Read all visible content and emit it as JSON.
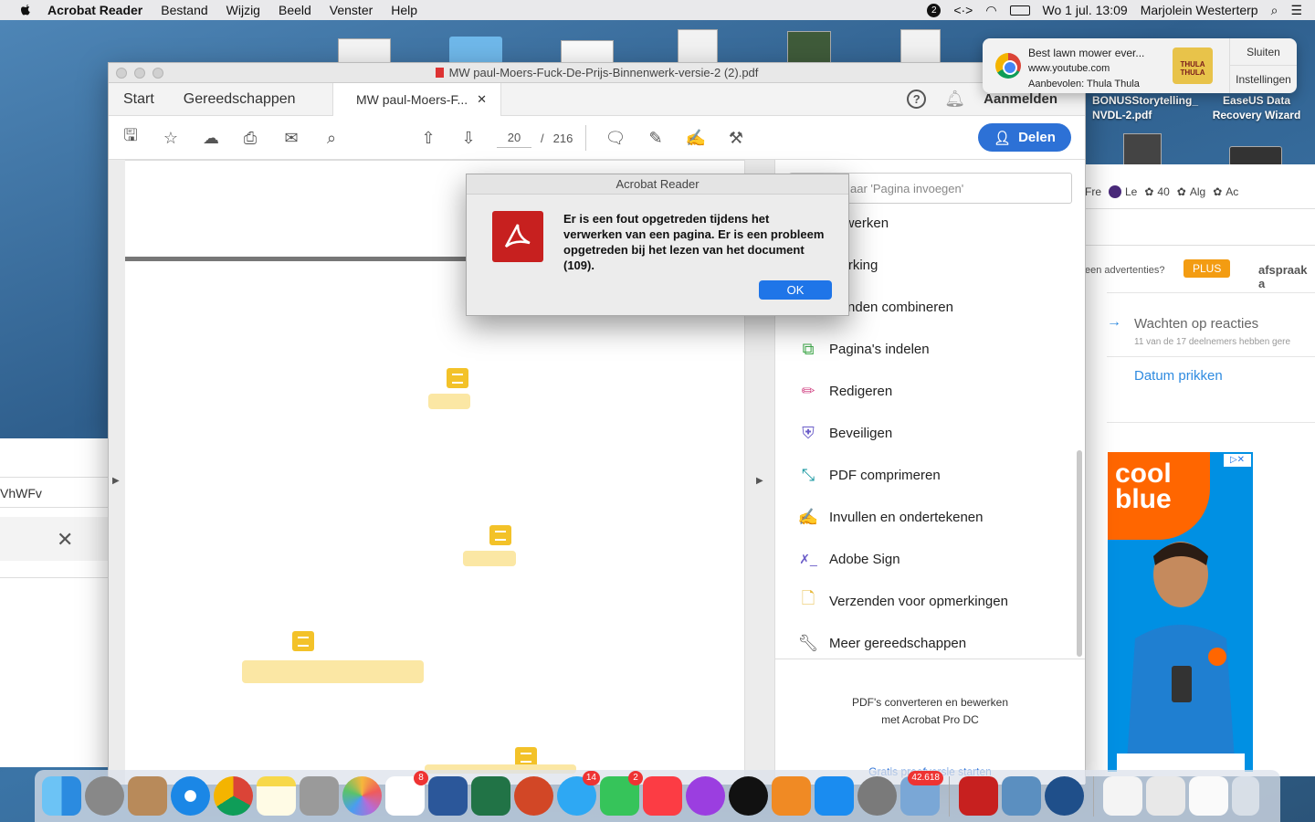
{
  "menubar": {
    "app_name": "Acrobat Reader",
    "menus": [
      "Bestand",
      "Wijzig",
      "Beeld",
      "Venster",
      "Help"
    ],
    "clock": "Wo 1 jul.  13:09",
    "user": "Marjolein Westerterp"
  },
  "acrobat": {
    "window_title": "MW paul-Moers-Fuck-De-Prijs-Binnenwerk-versie-2 (2).pdf",
    "tabs": {
      "start": "Start",
      "tools": "Gereedschappen",
      "doc": "MW paul-Moers-F..."
    },
    "sign_in": "Aanmelden",
    "page_current": "20",
    "page_total": "216",
    "share_label": "Delen",
    "tools_search_placeholder": "aar 'Pagina invoegen'",
    "tool_items": [
      "bewerken",
      "merking",
      "standen combineren",
      "Pagina's indelen",
      "Redigeren",
      "Beveiligen",
      "PDF comprimeren",
      "Invullen en ondertekenen",
      "Adobe Sign",
      "Verzenden voor opmerkingen",
      "Meer gereedschappen"
    ],
    "promo_text_1": "PDF's converteren en bewerken",
    "promo_text_2": "met Acrobat Pro DC",
    "promo_link": "Gratis proefversie starten"
  },
  "dialog": {
    "title": "Acrobat Reader",
    "message": "Er is een fout opgetreden tijdens het verwerken van een pagina. Er is een probleem opgetreden bij het lezen van het document (109).",
    "ok_label": "OK"
  },
  "notification": {
    "title": "Best lawn mower ever...",
    "site": "www.youtube.com",
    "recommended": "Aanbevolen: Thula Thula",
    "thumb_text": "THULA THULA",
    "close_label": "Sluiten",
    "settings_label": "Instellingen"
  },
  "desktop_files": [
    {
      "name": "BONUSStorytelling_NVDL-2.pdf"
    },
    {
      "name": "EaseUS Data Recovery Wizard"
    }
  ],
  "browser_right": {
    "tab_labels": [
      "Fre",
      "Le",
      "40",
      "Alg",
      "Ac"
    ],
    "ads_text": "een advertenties?",
    "plus_badge": "PLUS",
    "appointment": "afspraak a",
    "waiting_title": "Wachten op reacties",
    "waiting_sub": "11 van de 17 deelnemers hebben gere",
    "date_link": "Datum prikken",
    "ad_brand": "cool blue"
  },
  "browser_left": {
    "url_fragment": "VhWFv"
  },
  "dock": {
    "badges": {
      "reminders": "8",
      "messages": "14",
      "facetime": "2",
      "preview": "42.618"
    }
  }
}
